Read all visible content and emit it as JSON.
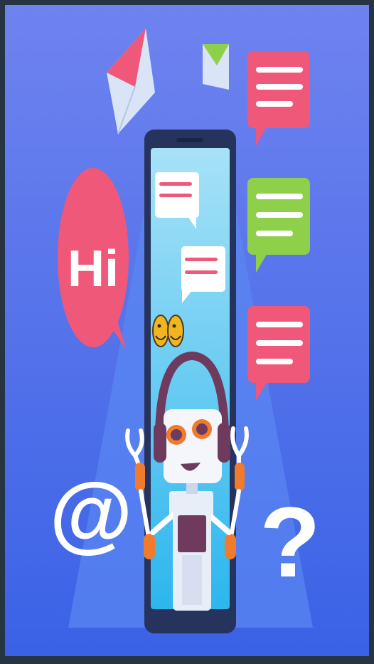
{
  "illustration": {
    "hi_bubble_text": "Hi",
    "at_symbol": "@",
    "question_symbol": "?",
    "icons": [
      "envelope-icon",
      "chat-bubble-icon",
      "emoji-icon",
      "robot-icon",
      "smartphone-icon"
    ],
    "colors": {
      "frame": "#273444",
      "background_top": "#6f83ef",
      "background_bottom": "#3a62e6",
      "beam": "#5a86f2",
      "phone_body": "#26345d",
      "phone_screen_top": "#a7e2f7",
      "phone_screen_bottom": "#2db6ee",
      "pink_bubble": "#f0587a",
      "green_bubble": "#8fd04a",
      "robot_purple": "#6e3a5e",
      "robot_orange": "#f07b2c",
      "emoji_yellow": "#f2b51f"
    }
  }
}
